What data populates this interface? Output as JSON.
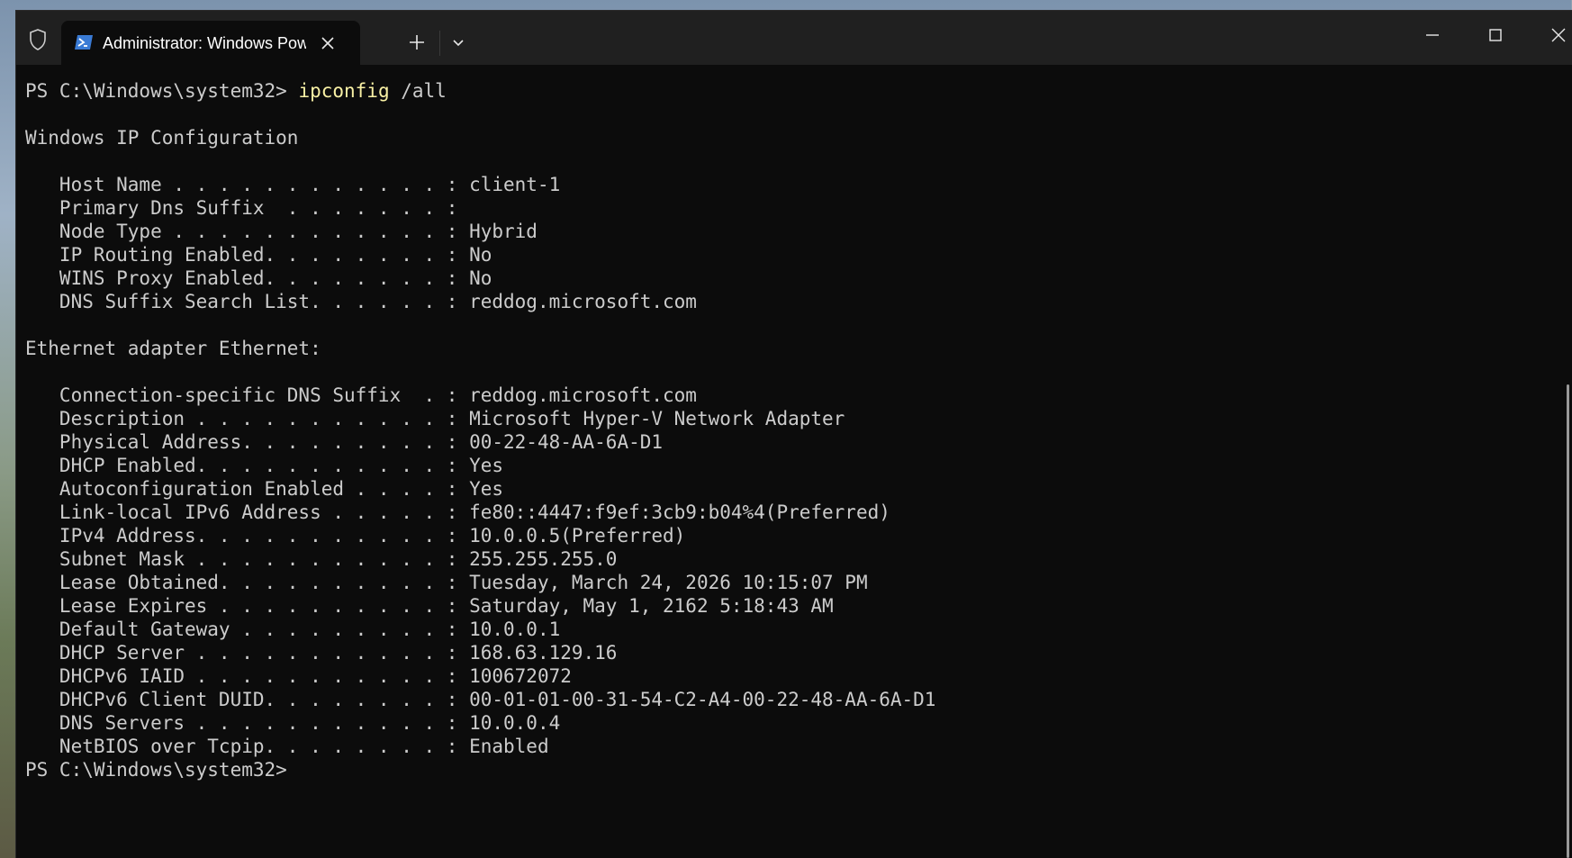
{
  "window": {
    "tab_title": "Administrator: Windows PowerShell",
    "tab_icon": "powershell-icon"
  },
  "terminal": {
    "prompt": "PS C:\\Windows\\system32> ",
    "command_name": "ipconfig",
    "command_args": " /all",
    "lines": [
      "",
      "Windows IP Configuration",
      "",
      "   Host Name . . . . . . . . . . . . : client-1",
      "   Primary Dns Suffix  . . . . . . . :",
      "   Node Type . . . . . . . . . . . . : Hybrid",
      "   IP Routing Enabled. . . . . . . . : No",
      "   WINS Proxy Enabled. . . . . . . . : No",
      "   DNS Suffix Search List. . . . . . : reddog.microsoft.com",
      "",
      "Ethernet adapter Ethernet:",
      "",
      "   Connection-specific DNS Suffix  . : reddog.microsoft.com",
      "   Description . . . . . . . . . . . : Microsoft Hyper-V Network Adapter",
      "   Physical Address. . . . . . . . . : 00-22-48-AA-6A-D1",
      "   DHCP Enabled. . . . . . . . . . . : Yes",
      "   Autoconfiguration Enabled . . . . : Yes",
      "   Link-local IPv6 Address . . . . . : fe80::4447:f9ef:3cb9:b04%4(Preferred)",
      "   IPv4 Address. . . . . . . . . . . : 10.0.0.5(Preferred)",
      "   Subnet Mask . . . . . . . . . . . : 255.255.255.0",
      "   Lease Obtained. . . . . . . . . . : Tuesday, March 24, 2026 10:15:07 PM",
      "   Lease Expires . . . . . . . . . . : Saturday, May 1, 2162 5:18:43 AM",
      "   Default Gateway . . . . . . . . . : 10.0.0.1",
      "   DHCP Server . . . . . . . . . . . : 168.63.129.16",
      "   DHCPv6 IAID . . . . . . . . . . . : 100672072",
      "   DHCPv6 Client DUID. . . . . . . . : 00-01-01-00-31-54-C2-A4-00-22-48-AA-6A-D1",
      "   DNS Servers . . . . . . . . . . . : 10.0.0.4",
      "   NetBIOS over Tcpip. . . . . . . . : Enabled"
    ],
    "final_prompt": "PS C:\\Windows\\system32>"
  },
  "colors": {
    "terminal_bg": "#0c0c0c",
    "terminal_fg": "#cccccc",
    "command_fg": "#f9f1a5",
    "titlebar_bg": "#202020"
  }
}
